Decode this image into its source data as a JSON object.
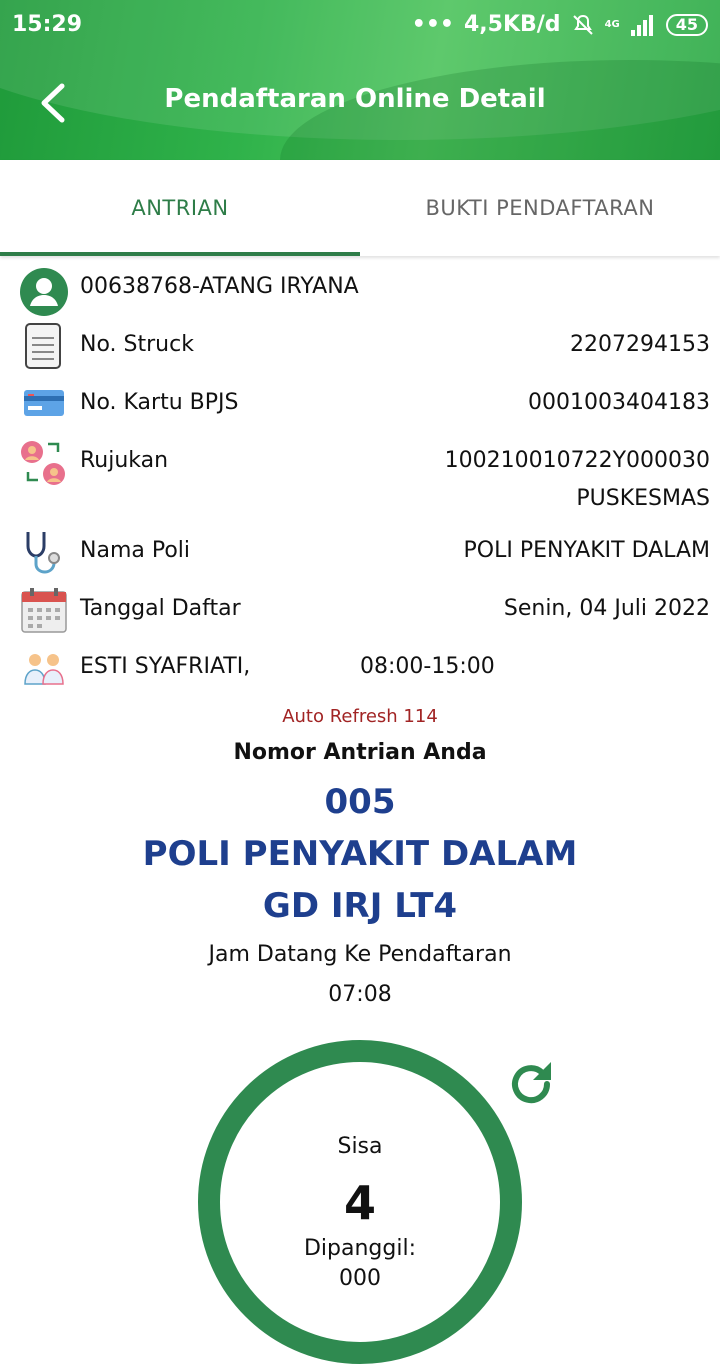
{
  "status_bar": {
    "time": "15:29",
    "network_speed": "4,5KB/d",
    "network_type": "4G",
    "battery": "45",
    "icons": [
      "dots-icon",
      "mute-icon",
      "signal-icon",
      "battery-icon"
    ]
  },
  "header": {
    "title": "Pendaftaran Online Detail",
    "back_icon": "chevron-left-icon",
    "accent": "#2fb24a"
  },
  "tabs": [
    {
      "label": "ANTRIAN",
      "active": true
    },
    {
      "label": "BUKTI PENDAFTARAN",
      "active": false
    }
  ],
  "patient": {
    "name": "00638768-ATANG IRYANA",
    "icon": "user-avatar-icon"
  },
  "rows": [
    {
      "label": "No. Struck",
      "value": "2207294153",
      "icon": "receipt-icon"
    },
    {
      "label": "No. Kartu BPJS",
      "value": "0001003404183",
      "icon": "card-icon"
    },
    {
      "label": "Rujukan",
      "value": "100210010722Y000030",
      "value2": "PUSKESMAS",
      "icon": "referral-icon"
    },
    {
      "label": "Nama Poli",
      "value": "POLI PENYAKIT DALAM",
      "icon": "stethoscope-icon"
    },
    {
      "label": "Tanggal Daftar",
      "value": "Senin, 04 Juli 2022",
      "icon": "calendar-icon"
    }
  ],
  "doctor": {
    "name": "ESTI SYAFRIATI,",
    "hours": "08:00-15:00",
    "icon": "doctors-icon"
  },
  "queue": {
    "auto_refresh": "Auto Refresh 114",
    "label": "Nomor Antrian Anda",
    "number": "005",
    "poli": "POLI PENYAKIT DALAM",
    "location": "GD IRJ LT4",
    "arrival_label": "Jam Datang Ke Pendaftaran",
    "arrival_time": "07:08",
    "sisa_label": "Sisa",
    "sisa": "4",
    "dipanggil_label": "Dipanggil:",
    "dipanggil": "000",
    "refresh_icon": "refresh-icon",
    "ring_color": "#2f8a50",
    "text_color": "#1e3f8e"
  }
}
